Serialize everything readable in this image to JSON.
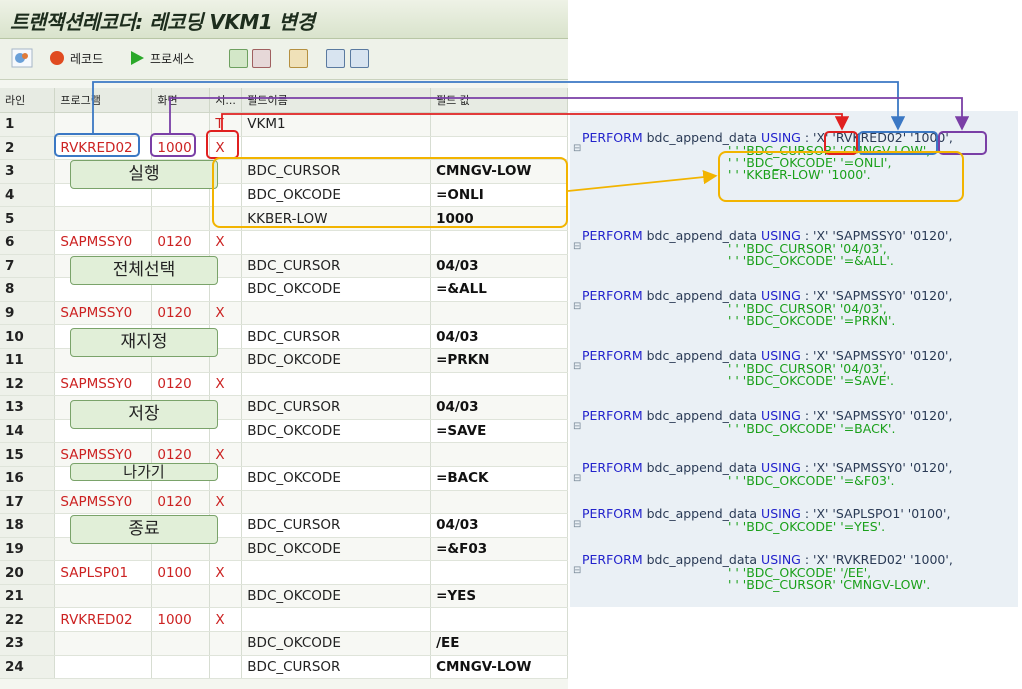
{
  "window": {
    "title": "트랜잭션레코더: 레코딩 VKM1 변경"
  },
  "toolbar": {
    "record_label": "레코드",
    "process_label": "프로세스"
  },
  "table": {
    "headers": [
      "라인",
      "프로그램",
      "화면",
      "시...",
      "필드이름",
      "필드 값"
    ],
    "rows": [
      [
        "1",
        "",
        "",
        "T",
        "VKM1",
        ""
      ],
      [
        "2",
        "RVKRED02",
        "1000",
        "X",
        "",
        ""
      ],
      [
        "3",
        "",
        "",
        "",
        "BDC_CURSOR",
        "CMNGV-LOW"
      ],
      [
        "4",
        "",
        "",
        "",
        "BDC_OKCODE",
        "=ONLI"
      ],
      [
        "5",
        "",
        "",
        "",
        "KKBER-LOW",
        "1000"
      ],
      [
        "6",
        "SAPMSSY0",
        "0120",
        "X",
        "",
        ""
      ],
      [
        "7",
        "",
        "",
        "",
        "BDC_CURSOR",
        "04/03"
      ],
      [
        "8",
        "",
        "",
        "",
        "BDC_OKCODE",
        "=&ALL"
      ],
      [
        "9",
        "SAPMSSY0",
        "0120",
        "X",
        "",
        ""
      ],
      [
        "10",
        "",
        "",
        "",
        "BDC_CURSOR",
        "04/03"
      ],
      [
        "11",
        "",
        "",
        "",
        "BDC_OKCODE",
        "=PRKN"
      ],
      [
        "12",
        "SAPMSSY0",
        "0120",
        "X",
        "",
        ""
      ],
      [
        "13",
        "",
        "",
        "",
        "BDC_CURSOR",
        "04/03"
      ],
      [
        "14",
        "",
        "",
        "",
        "BDC_OKCODE",
        "=SAVE"
      ],
      [
        "15",
        "SAPMSSY0",
        "0120",
        "X",
        "",
        ""
      ],
      [
        "16",
        "",
        "",
        "",
        "BDC_OKCODE",
        "=BACK"
      ],
      [
        "17",
        "SAPMSSY0",
        "0120",
        "X",
        "",
        ""
      ],
      [
        "18",
        "",
        "",
        "",
        "BDC_CURSOR",
        "04/03"
      ],
      [
        "19",
        "",
        "",
        "",
        "BDC_OKCODE",
        "=&F03"
      ],
      [
        "20",
        "SAPLSP01",
        "0100",
        "X",
        "",
        ""
      ],
      [
        "21",
        "",
        "",
        "",
        "BDC_OKCODE",
        "=YES"
      ],
      [
        "22",
        "RVKRED02",
        "1000",
        "X",
        "",
        ""
      ],
      [
        "23",
        "",
        "",
        "",
        "BDC_OKCODE",
        "/EE"
      ],
      [
        "24",
        "",
        "",
        "",
        "BDC_CURSOR",
        "CMNGV-LOW"
      ]
    ]
  },
  "steps": {
    "execute": "실행",
    "select_all": "전체선택",
    "reschedule": "재지정",
    "save": "저장",
    "exit": "나가기",
    "quit": "종료"
  },
  "code": {
    "perform": "PERFORM",
    "call": " bdc_append_data ",
    "using": "USING",
    "blocks": [
      {
        "head": " : 'X' 'RVKRED02' '1000',",
        "lines": [
          " ' ' 'BDC_CURSOR' 'CMNGV-LOW',",
          " ' ' 'BDC_OKCODE' '=ONLI',",
          " ' ' 'KKBER-LOW' '1000'."
        ]
      },
      {
        "head": " : 'X' 'SAPMSSY0' '0120',",
        "lines": [
          " ' ' 'BDC_CURSOR' '04/03',",
          " ' ' 'BDC_OKCODE' '=&ALL'."
        ]
      },
      {
        "head": " : 'X' 'SAPMSSY0' '0120',",
        "lines": [
          " ' ' 'BDC_CURSOR' '04/03',",
          " ' ' 'BDC_OKCODE' '=PRKN'."
        ]
      },
      {
        "head": " : 'X' 'SAPMSSY0' '0120',",
        "lines": [
          " ' ' 'BDC_CURSOR' '04/03',",
          " ' ' 'BDC_OKCODE' '=SAVE'."
        ]
      },
      {
        "head": " : 'X' 'SAPMSSY0' '0120',",
        "lines": [
          " ' ' 'BDC_OKCODE' '=BACK'."
        ]
      },
      {
        "head": " : 'X' 'SAPMSSY0' '0120',",
        "lines": [
          " ' ' 'BDC_OKCODE' '=&F03'."
        ]
      },
      {
        "head": " : 'X' 'SAPLSPO1' '0100',",
        "lines": [
          " ' ' 'BDC_OKCODE' '=YES'."
        ]
      },
      {
        "head": " : 'X' 'RVKRED02' '1000',",
        "lines": [
          " ' ' 'BDC_OKCODE' '/EE',",
          " ' ' 'BDC_CURSOR' 'CMNGV-LOW'."
        ]
      }
    ]
  },
  "colors": {
    "red": "#e02020",
    "blue": "#3b78c4",
    "purple": "#7a3fa6",
    "orange": "#f2b400",
    "green_btn": "#e1efd8"
  }
}
